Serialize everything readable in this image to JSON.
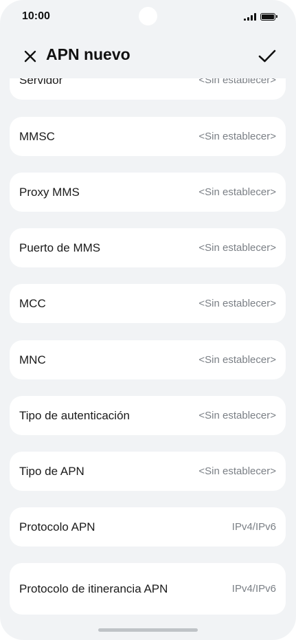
{
  "status_bar": {
    "time": "10:00"
  },
  "header": {
    "title": "APN nuevo"
  },
  "icons": {
    "close": "close-icon",
    "confirm": "check-icon"
  },
  "rows": [
    {
      "label": "Servidor",
      "value": "<Sin establecer>"
    },
    {
      "label": "MMSC",
      "value": "<Sin establecer>"
    },
    {
      "label": "Proxy MMS",
      "value": "<Sin establecer>"
    },
    {
      "label": "Puerto de MMS",
      "value": "<Sin establecer>"
    },
    {
      "label": "MCC",
      "value": "<Sin establecer>"
    },
    {
      "label": "MNC",
      "value": "<Sin establecer>"
    },
    {
      "label": "Tipo de autenticación",
      "value": "<Sin establecer>"
    },
    {
      "label": "Tipo de APN",
      "value": "<Sin establecer>"
    },
    {
      "label": "Protocolo APN",
      "value": "IPv4/IPv6"
    },
    {
      "label": "Protocolo de itinerancia APN",
      "value": "IPv4/IPv6"
    }
  ]
}
